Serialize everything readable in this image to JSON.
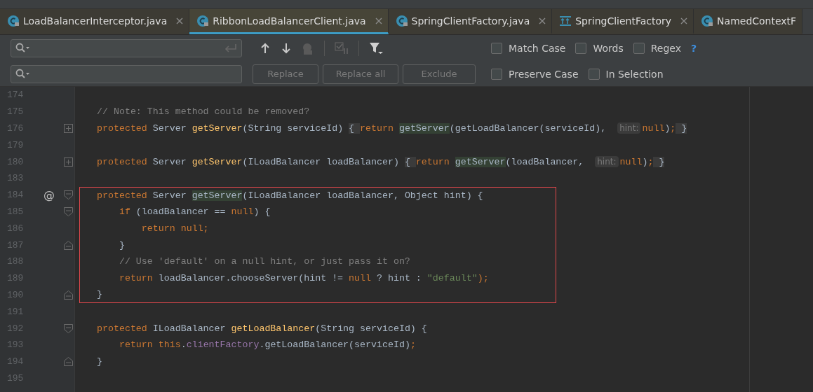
{
  "tabs": [
    {
      "label": "LoadBalancerInterceptor.java",
      "kind": "class",
      "selected": false,
      "closable": true
    },
    {
      "label": "RibbonLoadBalancerClient.java",
      "kind": "class",
      "selected": true,
      "closable": true
    },
    {
      "label": "SpringClientFactory.java",
      "kind": "class",
      "selected": false,
      "closable": true
    },
    {
      "label": "SpringClientFactory",
      "kind": "structure",
      "selected": false,
      "closable": true
    },
    {
      "label": "NamedContextF",
      "kind": "class",
      "selected": false,
      "closable": false
    }
  ],
  "find": {
    "buttons": [
      {
        "label": "Replace",
        "disabled": true
      },
      {
        "label": "Replace all",
        "disabled": true
      },
      {
        "label": "Exclude",
        "disabled": true
      }
    ],
    "options_row_1": [
      {
        "label": "Match Case",
        "checked": false
      },
      {
        "label": "Words",
        "checked": false
      },
      {
        "label": "Regex",
        "checked": false
      }
    ],
    "help": "?",
    "options_row_2": [
      {
        "label": "Preserve Case",
        "checked": false
      },
      {
        "label": "In Selection",
        "checked": false
      }
    ]
  },
  "editor": {
    "lines": [
      {
        "number": "174",
        "kind": "plain",
        "boxed": false
      },
      {
        "number": "175",
        "kind": "plain",
        "boxed": false,
        "tokens": [
          {
            "t": "// Note: This method could be removed?",
            "kind": "comment"
          }
        ]
      },
      {
        "number": "176",
        "kind": "folded",
        "boxed": false,
        "tokens": [
          {
            "t": "protected ",
            "kind": "keyword"
          },
          {
            "t": "Server ",
            "kind": "plain"
          },
          {
            "t": "getServer",
            "kind": "method"
          },
          {
            "t": "(String serviceId) ",
            "kind": "plain"
          },
          {
            "t": "{ ",
            "kind": "folded"
          },
          {
            "t": "return ",
            "kind": "keyword"
          },
          {
            "t": "getServer",
            "kind": "usage"
          },
          {
            "t": "(getLoadBalancer(serviceId), ",
            "kind": "plain"
          },
          {
            "t": "hint:",
            "kind": "hint"
          },
          {
            "t": "null",
            "kind": "keyword"
          },
          {
            "t": ")",
            "kind": "plain"
          },
          {
            "t": ";",
            "kind": "keyword"
          },
          {
            "t": " }",
            "kind": "folded"
          }
        ]
      },
      {
        "number": "179",
        "kind": "plain",
        "boxed": false
      },
      {
        "number": "180",
        "kind": "folded",
        "boxed": false,
        "tokens": [
          {
            "t": "protected ",
            "kind": "keyword"
          },
          {
            "t": "Server ",
            "kind": "plain"
          },
          {
            "t": "getServer",
            "kind": "method"
          },
          {
            "t": "(ILoadBalancer loadBalancer) ",
            "kind": "plain"
          },
          {
            "t": "{ ",
            "kind": "folded"
          },
          {
            "t": "return ",
            "kind": "keyword"
          },
          {
            "t": "getServer",
            "kind": "usage"
          },
          {
            "t": "(loadBalancer, ",
            "kind": "plain"
          },
          {
            "t": "hint:",
            "kind": "hint"
          },
          {
            "t": "null",
            "kind": "keyword"
          },
          {
            "t": ")",
            "kind": "plain"
          },
          {
            "t": ";",
            "kind": "keyword"
          },
          {
            "t": " }",
            "kind": "folded"
          }
        ]
      },
      {
        "number": "183",
        "kind": "plain",
        "boxed": false
      },
      {
        "number": "184",
        "kind": "fold-start",
        "boxed": true,
        "marker": "@",
        "tokens": [
          {
            "t": "protected ",
            "kind": "keyword"
          },
          {
            "t": "Server ",
            "kind": "plain"
          },
          {
            "t": "getServer",
            "kind": "usage"
          },
          {
            "t": "(ILoadBalancer loadBalancer, Object hint) {",
            "kind": "plain"
          }
        ]
      },
      {
        "number": "185",
        "kind": "fold-start",
        "boxed": true,
        "tokens": [
          {
            "t": "    if ",
            "kind": "keyword"
          },
          {
            "t": "(loadBalancer == ",
            "kind": "plain"
          },
          {
            "t": "null",
            "kind": "keyword"
          },
          {
            "t": ") {",
            "kind": "plain"
          }
        ]
      },
      {
        "number": "186",
        "kind": "plain",
        "boxed": true,
        "tokens": [
          {
            "t": "        return null;",
            "kind": "keyword"
          }
        ]
      },
      {
        "number": "187",
        "kind": "fold-end",
        "boxed": true,
        "tokens": [
          {
            "t": "    }",
            "kind": "plain"
          }
        ]
      },
      {
        "number": "188",
        "kind": "plain",
        "boxed": true,
        "tokens": [
          {
            "t": "    // Use 'default' on a null hint, or just pass it on?",
            "kind": "comment"
          }
        ]
      },
      {
        "number": "189",
        "kind": "plain",
        "boxed": true,
        "tokens": [
          {
            "t": "    return ",
            "kind": "keyword"
          },
          {
            "t": "loadBalancer.chooseServer(hint != ",
            "kind": "plain"
          },
          {
            "t": "null ",
            "kind": "keyword"
          },
          {
            "t": "? hint : ",
            "kind": "plain"
          },
          {
            "t": "\"default\"",
            "kind": "string"
          },
          {
            "t": ");",
            "kind": "keyword"
          }
        ]
      },
      {
        "number": "190",
        "kind": "fold-end",
        "boxed": true,
        "tokens": [
          {
            "t": "}",
            "kind": "plain"
          }
        ]
      },
      {
        "number": "191",
        "kind": "plain",
        "boxed": false
      },
      {
        "number": "192",
        "kind": "fold-start",
        "boxed": false,
        "tokens": [
          {
            "t": "protected ",
            "kind": "keyword"
          },
          {
            "t": "ILoadBalancer ",
            "kind": "plain"
          },
          {
            "t": "getLoadBalancer",
            "kind": "method"
          },
          {
            "t": "(String serviceId) {",
            "kind": "plain"
          }
        ]
      },
      {
        "number": "193",
        "kind": "plain",
        "boxed": false,
        "tokens": [
          {
            "t": "    return this",
            "kind": "keyword"
          },
          {
            "t": ".",
            "kind": "plain"
          },
          {
            "t": "clientFactory",
            "kind": "field"
          },
          {
            "t": ".getLoadBalancer(serviceId)",
            "kind": "plain"
          },
          {
            "t": ";",
            "kind": "keyword"
          }
        ]
      },
      {
        "number": "194",
        "kind": "fold-end",
        "boxed": false,
        "tokens": [
          {
            "t": "}",
            "kind": "plain"
          }
        ]
      },
      {
        "number": "195",
        "kind": "plain",
        "boxed": false
      }
    ]
  }
}
